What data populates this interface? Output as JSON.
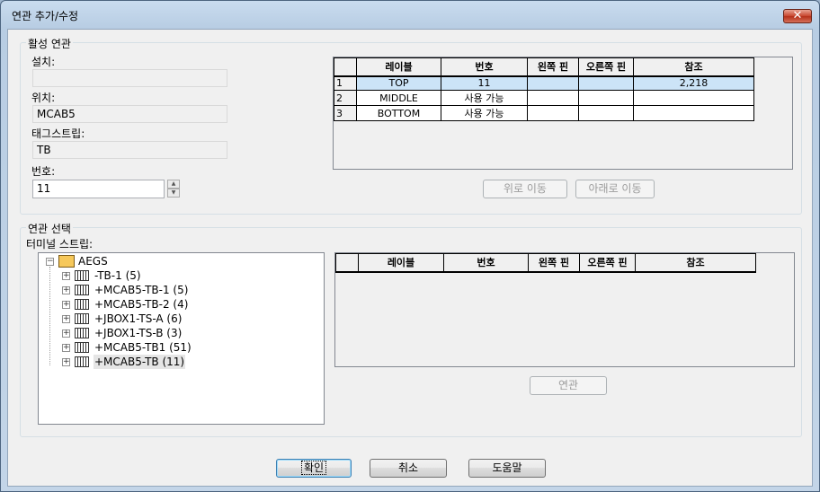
{
  "window": {
    "title": "연관 추가/수정",
    "close_label": "✕"
  },
  "active": {
    "group_label": "활성 연관",
    "install_label": "설치:",
    "install_value": "",
    "location_label": "위치:",
    "location_value": "MCAB5",
    "tagstrip_label": "태그스트립:",
    "tagstrip_value": "TB",
    "number_label": "번호:",
    "number_value": "11",
    "grid": {
      "headers": [
        "레이블",
        "번호",
        "왼쪽 핀",
        "오른쪽 핀",
        "참조"
      ],
      "rows": [
        {
          "index": "1",
          "label": "TOP",
          "number": "11",
          "left_pin": "",
          "right_pin": "",
          "ref": "2,218"
        },
        {
          "index": "2",
          "label": "MIDDLE",
          "number": "사용 가능",
          "left_pin": "",
          "right_pin": "",
          "ref": ""
        },
        {
          "index": "3",
          "label": "BOTTOM",
          "number": "사용 가능",
          "left_pin": "",
          "right_pin": "",
          "ref": ""
        }
      ]
    },
    "move_up_label": "위로 이동",
    "move_down_label": "아래로 이동"
  },
  "select": {
    "group_label": "연관 선택",
    "strip_label": "터미널 스트립:",
    "tree": {
      "root": "AEGS",
      "children": [
        "-TB-1 (5)",
        "+MCAB5-TB-1 (5)",
        "+MCAB5-TB-2 (4)",
        "+JBOX1-TS-A (6)",
        "+JBOX1-TS-B (3)",
        "+MCAB5-TB1 (51)",
        "+MCAB5-TB (11)"
      ]
    },
    "grid": {
      "headers": [
        "레이블",
        "번호",
        "왼쪽 핀",
        "오른쪽 핀",
        "참조"
      ]
    },
    "associate_label": "연관"
  },
  "footer": {
    "ok_label": "확인",
    "cancel_label": "취소",
    "help_label": "도움말"
  },
  "icons": {
    "close": "close-icon",
    "expand": "expand-icon",
    "root": "folder-icon",
    "strip": "terminal-strip-icon",
    "spin_up": "spin-up-icon",
    "spin_down": "spin-down-icon"
  },
  "colors": {
    "selected_row": "#cce4f7",
    "close_button": "#c8452e"
  }
}
